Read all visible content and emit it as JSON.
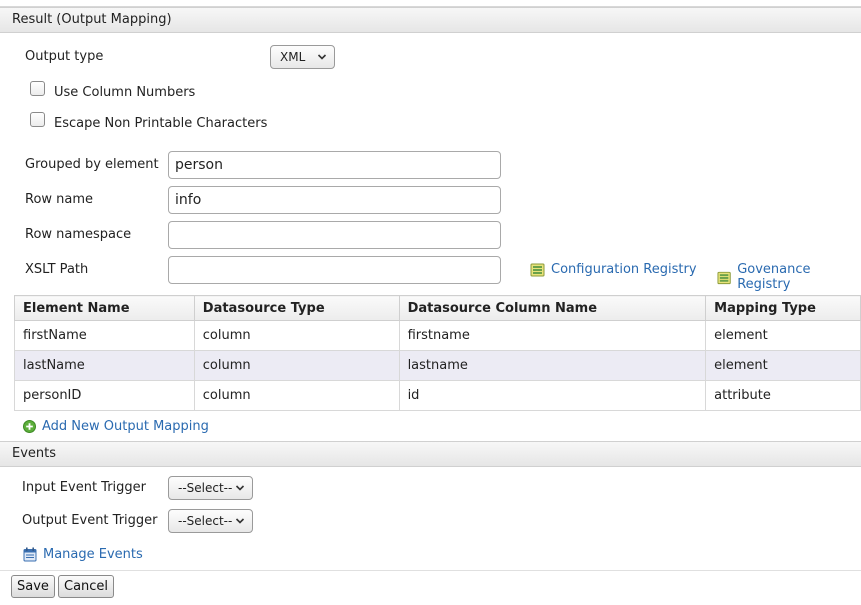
{
  "result_section": {
    "title": "Result (Output Mapping)",
    "output_type_label": "Output type",
    "output_type_value": "XML",
    "use_column_numbers_label": "Use Column Numbers",
    "escape_non_printable_label": "Escape Non Printable Characters",
    "grouped_by_label": "Grouped by element",
    "grouped_by_value": "person",
    "row_name_label": "Row name",
    "row_name_value": "info",
    "row_namespace_label": "Row namespace",
    "row_namespace_value": "",
    "xslt_path_label": "XSLT Path",
    "xslt_path_value": "",
    "config_registry_link": "Configuration Registry",
    "governance_registry_link": "Govenance Registry",
    "table": {
      "headers": [
        "Element Name",
        "Datasource Type",
        "Datasource Column Name",
        "Mapping Type"
      ],
      "rows": [
        [
          "firstName",
          "column",
          "firstname",
          "element"
        ],
        [
          "lastName",
          "column",
          "lastname",
          "element"
        ],
        [
          "personID",
          "column",
          "id",
          "attribute"
        ]
      ]
    },
    "add_mapping_link": "Add New Output Mapping"
  },
  "events_section": {
    "title": "Events",
    "input_trigger_label": "Input Event Trigger",
    "input_trigger_value": "--Select--",
    "output_trigger_label": "Output Event Trigger",
    "output_trigger_value": "--Select--",
    "manage_events_link": "Manage Events"
  },
  "buttons": {
    "save": "Save",
    "cancel": "Cancel"
  },
  "icons": {
    "registry": "registry-icon",
    "add": "add-icon",
    "calendar": "calendar-icon",
    "chevron": "chevron-down-icon"
  },
  "colors": {
    "link": "#2a6ab0",
    "alt_row": "#ecebf4"
  }
}
